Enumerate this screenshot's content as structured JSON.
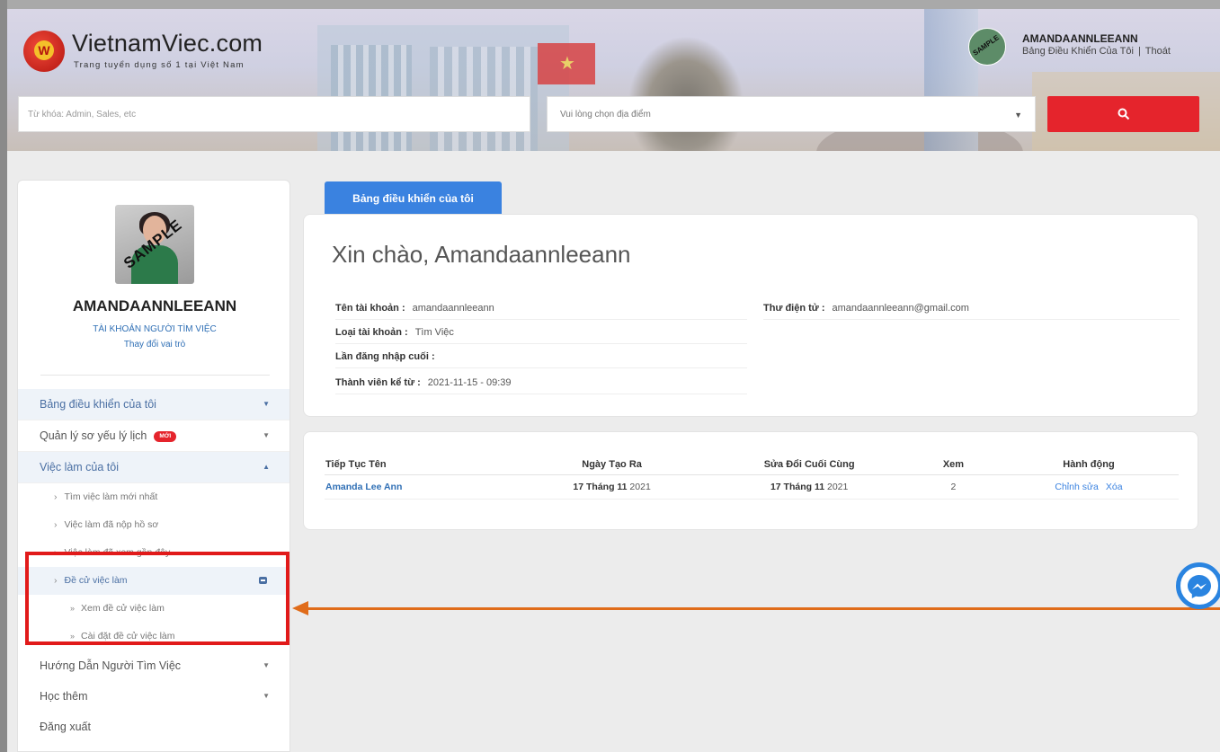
{
  "header": {
    "logo_name": "VietnamViec.com",
    "logo_tagline": "Trang tuyển dụng số 1 tại Việt Nam",
    "logo_letter": "W",
    "user_name": "AMANDAANNLEEANN",
    "dashboard_link": "Bảng Điều Khiển Của Tôi",
    "separator": "|",
    "logout_link": "Thoát",
    "avatar_text": "SAMPLE"
  },
  "search": {
    "keyword_placeholder": "Từ khóa: Admin, Sales, etc",
    "location_placeholder": "Vui lòng chọn địa điểm",
    "search_icon": "search-icon",
    "button_color": "#e5242c"
  },
  "sidebar": {
    "avatar_text": "SAMPLE",
    "name": "AMANDAANNLEEANN",
    "account_type": "TÀI KHOẢN NGƯỜI TÌM VIỆC",
    "change_role": "Thay đổi vai trò",
    "menu": {
      "dashboard": "Bảng điều khiển của tôi",
      "resume": "Quản lý sơ yếu lý lịch",
      "new_badge": "MỚI",
      "my_jobs": "Việc làm của tôi",
      "sub_latest": "Tìm việc làm mới nhất",
      "sub_applied": "Việc làm đã nộp hồ sơ",
      "sub_viewed": "Việc làm đã xem gần đây",
      "sub_recommend": "Đề cử việc làm",
      "subsub_view": "Xem đề cử việc làm",
      "subsub_settings": "Cài đặt đề cử việc làm",
      "guide": "Hướng Dẫn Người Tìm Việc",
      "learn": "Học thêm",
      "logout": "Đăng xuất"
    }
  },
  "main": {
    "tab_label": "Bảng điều khiển của tôi",
    "greeting": "Xin chào, Amandaannleeann",
    "account_name_label": "Tên tài khoản :",
    "account_name_value": "amandaannleeann",
    "account_type_label": "Loại tài khoản :",
    "account_type_value": "Tìm Việc",
    "last_login_label": "Lần đăng nhập cuối :",
    "last_login_value": "",
    "member_since_label": "Thành viên kể từ :",
    "member_since_value": "2021-11-15 - 09:39",
    "email_label": "Thư điện tử :",
    "email_value": "amandaannleeann@gmail.com"
  },
  "resume_table": {
    "headers": [
      "Tiếp Tục Tên",
      "Ngày Tạo Ra",
      "Sửa Đổi Cuối Cùng",
      "Xem",
      "Hành động"
    ],
    "rows": [
      {
        "name": "Amanda Lee Ann",
        "created_day": "17 Tháng 11",
        "created_year": "2021",
        "modified_day": "17 Tháng 11",
        "modified_year": "2021",
        "views": "2",
        "edit": "Chỉnh sửa",
        "delete": "Xóa"
      }
    ]
  },
  "colors": {
    "accent_blue": "#3a82e0",
    "brand_red": "#e5242c",
    "annotation_red": "#e11a1a",
    "annotation_orange": "#e06c1a"
  }
}
